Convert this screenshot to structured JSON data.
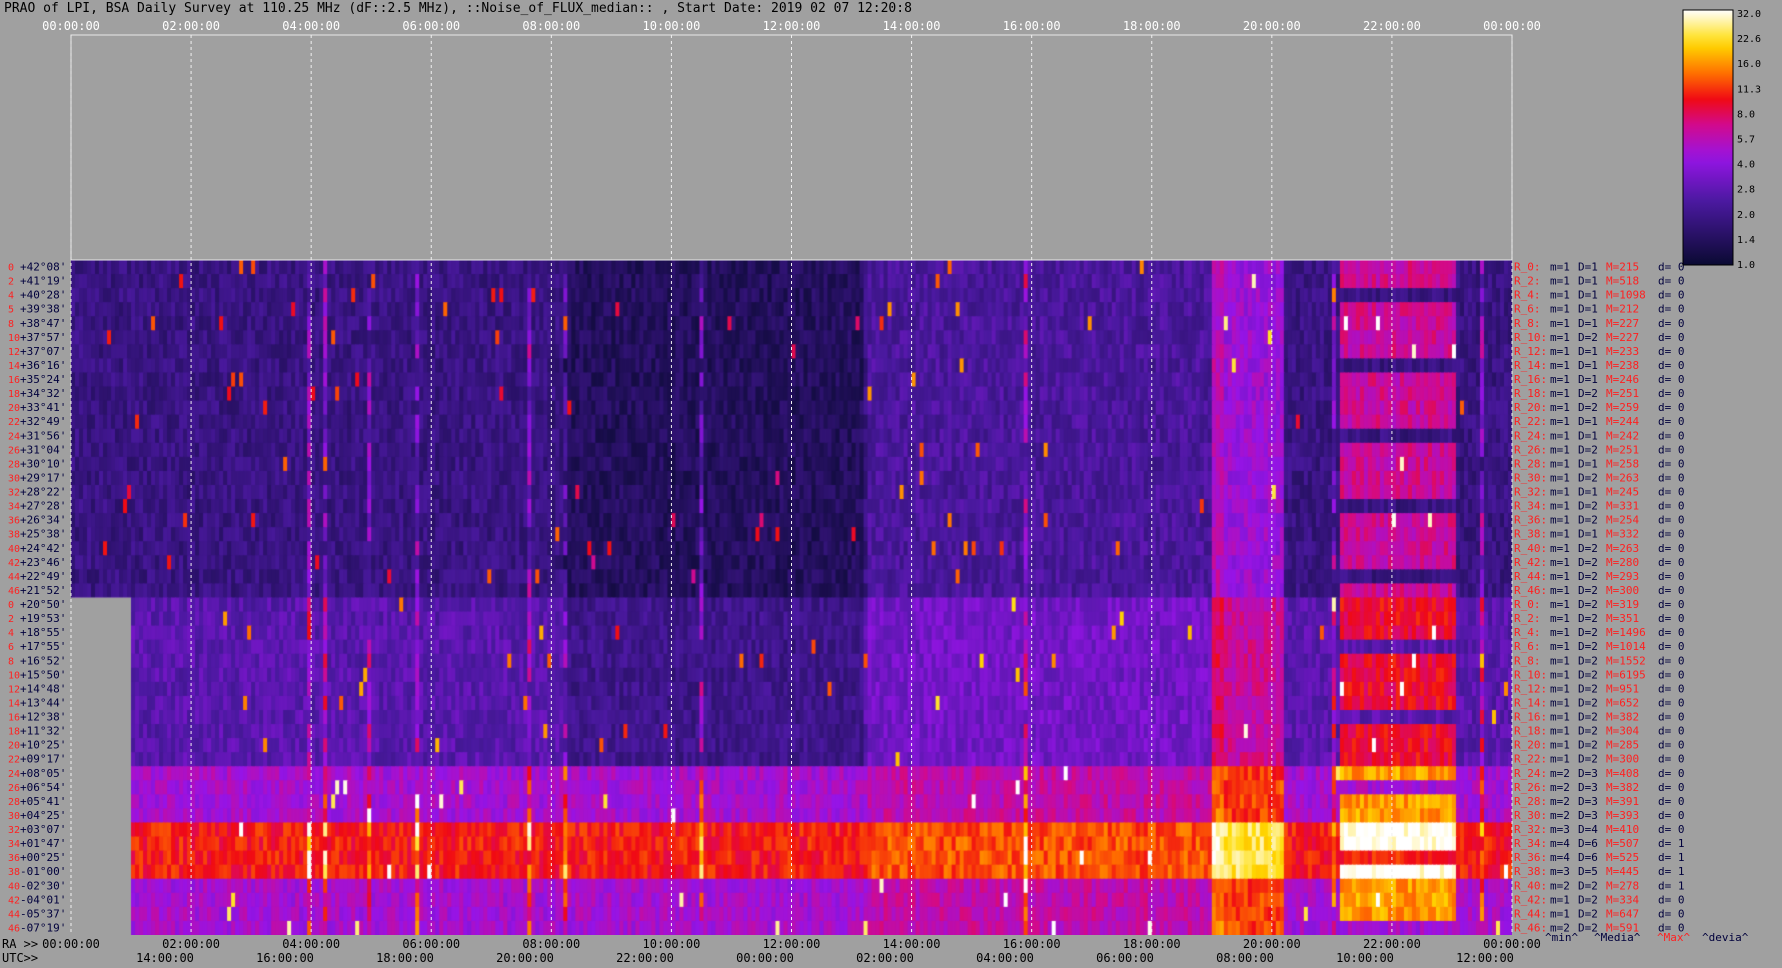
{
  "title": "PRAO of LPI, BSA Daily Survey at 110.25 MHz (dF::2.5 MHz), ::Noise_of_FLUX_median:: , Start Date: 2019 02 07 12:20:8",
  "chart_data": {
    "type": "heatmap",
    "title": "PRAO of LPI, BSA Daily Survey at 110.25 MHz (dF::2.5 MHz), ::Noise_of_FLUX_median:: , Start Date: 2019 02 07 12:20:8",
    "top_time_ticks": [
      "00:00:00",
      "02:00:00",
      "04:00:00",
      "06:00:00",
      "08:00:00",
      "10:00:00",
      "12:00:00",
      "14:00:00",
      "16:00:00",
      "18:00:00",
      "20:00:00",
      "22:00:00",
      "00:00:00"
    ],
    "bottom_ra_prefix": "RA >>",
    "bottom_ra_ticks": [
      "00:00:00",
      "02:00:00",
      "04:00:00",
      "06:00:00",
      "08:00:00",
      "10:00:00",
      "12:00:00",
      "14:00:00",
      "16:00:00",
      "18:00:00",
      "20:00:00",
      "22:00:00",
      "00:00:00"
    ],
    "bottom_utc_prefix": "UTC>>",
    "bottom_utc_ticks": [
      "14:00:00",
      "16:00:00",
      "18:00:00",
      "20:00:00",
      "22:00:00",
      "00:00:00",
      "02:00:00",
      "04:00:00",
      "06:00:00",
      "08:00:00",
      "10:00:00",
      "12:00:00"
    ],
    "declinations": [
      "+42°08'",
      "+41°19'",
      "+40°28'",
      "+39°38'",
      "+38°47'",
      "+37°57'",
      "+37°07'",
      "+36°16'",
      "+35°24'",
      "+34°32'",
      "+33°41'",
      "+32°49'",
      "+31°56'",
      "+31°04'",
      "+30°10'",
      "+29°17'",
      "+28°22'",
      "+27°28'",
      "+26°34'",
      "+25°38'",
      "+24°42'",
      "+23°46'",
      "+22°49'",
      "+21°52'",
      "+20°50'",
      "+19°53'",
      "+18°55'",
      "+17°55'",
      "+16°52'",
      "+15°50'",
      "+14°48'",
      "+13°44'",
      "+12°38'",
      "+11°32'",
      "+10°25'",
      "+09°17'",
      "+08°05'",
      "+06°54'",
      "+05°41'",
      "+04°25'",
      "+03°07'",
      "+01°47'",
      "+00°25'",
      "-01°00'",
      "-02°30'",
      "-04°01'",
      "-05°37'",
      "-07°19'"
    ],
    "beam_numbers": [
      "0",
      "2",
      "4",
      "5",
      "8",
      "10",
      "12",
      "14",
      "16",
      "18",
      "20",
      "22",
      "24",
      "26",
      "28",
      "30",
      "32",
      "34",
      "36",
      "38",
      "40",
      "42",
      "44",
      "46",
      "0",
      "2",
      "4",
      "6",
      "8",
      "10",
      "12",
      "14",
      "16",
      "18",
      "20",
      "22",
      "24",
      "26",
      "28",
      "30",
      "32",
      "34",
      "36",
      "38",
      "40",
      "42",
      "44",
      "46"
    ],
    "row_stats": [
      {
        "r": "R_0:",
        "m": "m=1",
        "D": "D=1",
        "M": "M=215",
        "d": "d= 0"
      },
      {
        "r": "R_2:",
        "m": "m=1",
        "D": "D=1",
        "M": "M=518",
        "d": "d= 0"
      },
      {
        "r": "R_4:",
        "m": "m=1",
        "D": "D=1",
        "M": "M=1098",
        "d": "d= 0"
      },
      {
        "r": "R_6:",
        "m": "m=1",
        "D": "D=1",
        "M": "M=212",
        "d": "d= 0"
      },
      {
        "r": "R_8:",
        "m": "m=1",
        "D": "D=1",
        "M": "M=227",
        "d": "d= 0"
      },
      {
        "r": "R_10:",
        "m": "m=1",
        "D": "D=2",
        "M": "M=227",
        "d": "d= 0"
      },
      {
        "r": "R_12:",
        "m": "m=1",
        "D": "D=1",
        "M": "M=233",
        "d": "d= 0"
      },
      {
        "r": "R_14:",
        "m": "m=1",
        "D": "D=1",
        "M": "M=238",
        "d": "d= 0"
      },
      {
        "r": "R_16:",
        "m": "m=1",
        "D": "D=1",
        "M": "M=246",
        "d": "d= 0"
      },
      {
        "r": "R_18:",
        "m": "m=1",
        "D": "D=2",
        "M": "M=251",
        "d": "d= 0"
      },
      {
        "r": "R_20:",
        "m": "m=1",
        "D": "D=2",
        "M": "M=259",
        "d": "d= 0"
      },
      {
        "r": "R_22:",
        "m": "m=1",
        "D": "D=1",
        "M": "M=244",
        "d": "d= 0"
      },
      {
        "r": "R_24:",
        "m": "m=1",
        "D": "D=1",
        "M": "M=242",
        "d": "d= 0"
      },
      {
        "r": "R_26:",
        "m": "m=1",
        "D": "D=2",
        "M": "M=251",
        "d": "d= 0"
      },
      {
        "r": "R_28:",
        "m": "m=1",
        "D": "D=1",
        "M": "M=258",
        "d": "d= 0"
      },
      {
        "r": "R_30:",
        "m": "m=1",
        "D": "D=2",
        "M": "M=263",
        "d": "d= 0"
      },
      {
        "r": "R_32:",
        "m": "m=1",
        "D": "D=1",
        "M": "M=245",
        "d": "d= 0"
      },
      {
        "r": "R_34:",
        "m": "m=1",
        "D": "D=2",
        "M": "M=331",
        "d": "d= 0"
      },
      {
        "r": "R_36:",
        "m": "m=1",
        "D": "D=2",
        "M": "M=254",
        "d": "d= 0"
      },
      {
        "r": "R_38:",
        "m": "m=1",
        "D": "D=1",
        "M": "M=332",
        "d": "d= 0"
      },
      {
        "r": "R_40:",
        "m": "m=1",
        "D": "D=2",
        "M": "M=263",
        "d": "d= 0"
      },
      {
        "r": "R_42:",
        "m": "m=1",
        "D": "D=2",
        "M": "M=280",
        "d": "d= 0"
      },
      {
        "r": "R_44:",
        "m": "m=1",
        "D": "D=2",
        "M": "M=293",
        "d": "d= 0"
      },
      {
        "r": "R_46:",
        "m": "m=1",
        "D": "D=2",
        "M": "M=300",
        "d": "d= 0"
      },
      {
        "r": "R_0:",
        "m": "m=1",
        "D": "D=2",
        "M": "M=319",
        "d": "d= 0"
      },
      {
        "r": "R_2:",
        "m": "m=1",
        "D": "D=2",
        "M": "M=351",
        "d": "d= 0"
      },
      {
        "r": "R_4:",
        "m": "m=1",
        "D": "D=2",
        "M": "M=1496",
        "d": "d= 0"
      },
      {
        "r": "R_6:",
        "m": "m=1",
        "D": "D=2",
        "M": "M=1014",
        "d": "d= 0"
      },
      {
        "r": "R_8:",
        "m": "m=1",
        "D": "D=2",
        "M": "M=1552",
        "d": "d= 0"
      },
      {
        "r": "R_10:",
        "m": "m=1",
        "D": "D=2",
        "M": "M=6195",
        "d": "d= 0"
      },
      {
        "r": "R_12:",
        "m": "m=1",
        "D": "D=2",
        "M": "M=951",
        "d": "d= 0"
      },
      {
        "r": "R_14:",
        "m": "m=1",
        "D": "D=2",
        "M": "M=652",
        "d": "d= 0"
      },
      {
        "r": "R_16:",
        "m": "m=1",
        "D": "D=2",
        "M": "M=382",
        "d": "d= 0"
      },
      {
        "r": "R_18:",
        "m": "m=1",
        "D": "D=2",
        "M": "M=304",
        "d": "d= 0"
      },
      {
        "r": "R_20:",
        "m": "m=1",
        "D": "D=2",
        "M": "M=285",
        "d": "d= 0"
      },
      {
        "r": "R_22:",
        "m": "m=1",
        "D": "D=2",
        "M": "M=300",
        "d": "d= 0"
      },
      {
        "r": "R_24:",
        "m": "m=2",
        "D": "D=3",
        "M": "M=408",
        "d": "d= 0"
      },
      {
        "r": "R_26:",
        "m": "m=2",
        "D": "D=3",
        "M": "M=382",
        "d": "d= 0"
      },
      {
        "r": "R_28:",
        "m": "m=2",
        "D": "D=3",
        "M": "M=391",
        "d": "d= 0"
      },
      {
        "r": "R_30:",
        "m": "m=2",
        "D": "D=3",
        "M": "M=393",
        "d": "d= 0"
      },
      {
        "r": "R_32:",
        "m": "m=3",
        "D": "D=4",
        "M": "M=410",
        "d": "d= 0"
      },
      {
        "r": "R_34:",
        "m": "m=4",
        "D": "D=6",
        "M": "M=507",
        "d": "d= 1"
      },
      {
        "r": "R_36:",
        "m": "m=4",
        "D": "D=6",
        "M": "M=525",
        "d": "d= 1"
      },
      {
        "r": "R_38:",
        "m": "m=3",
        "D": "D=5",
        "M": "M=445",
        "d": "d= 1"
      },
      {
        "r": "R_40:",
        "m": "m=2",
        "D": "D=2",
        "M": "M=278",
        "d": "d= 1"
      },
      {
        "r": "R_42:",
        "m": "m=1",
        "D": "D=2",
        "M": "M=334",
        "d": "d= 0"
      },
      {
        "r": "R_44:",
        "m": "m=1",
        "D": "D=2",
        "M": "M=647",
        "d": "d= 0"
      },
      {
        "r": "R_46:",
        "m": "m=2",
        "D": "D=2",
        "M": "M=591",
        "d": "d= 0"
      }
    ],
    "stats_legend": [
      "^min^",
      "^Media^",
      "^Max^",
      "^devia^"
    ],
    "colorbar_ticks": [
      "32.0",
      "22.6",
      "16.0",
      "11.3",
      "8.0",
      "5.7",
      "4.0",
      "2.8",
      "2.0",
      "1.4",
      "1.0"
    ],
    "colors": {
      "background": "#a0a0a0",
      "dec_label": "#00003c",
      "beam_label": "#ff2020",
      "stat_r": "#ff2020",
      "stat_mD": "#00003c",
      "stat_M": "#ff2020"
    }
  }
}
